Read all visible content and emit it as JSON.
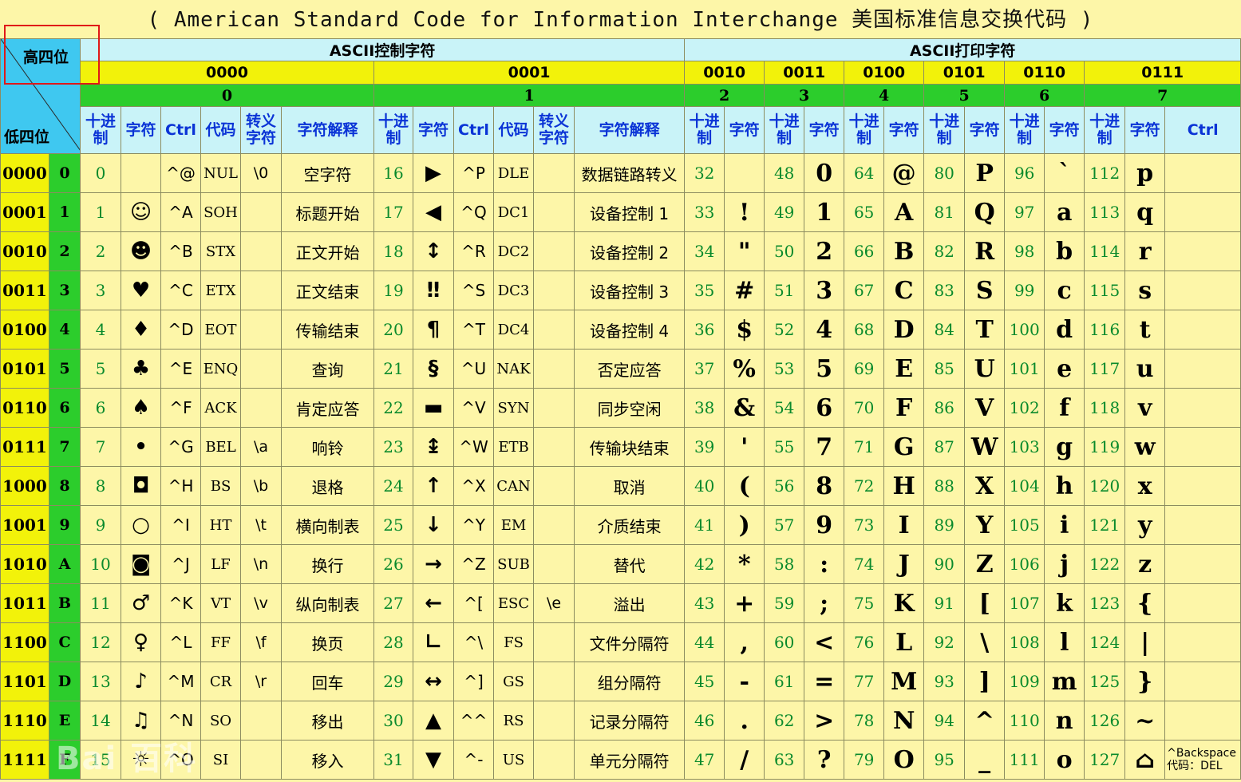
{
  "title": "( American Standard Code for Information Interchange  美国标准信息交换代码 )",
  "corner": {
    "high": "高四位",
    "low": "低四位"
  },
  "sections": {
    "control": "ASCII控制字符",
    "printable": "ASCII打印字符"
  },
  "high_bits": [
    "0000",
    "0001",
    "0010",
    "0011",
    "0100",
    "0101",
    "0110",
    "0111"
  ],
  "high_hex": [
    "0",
    "1",
    "2",
    "3",
    "4",
    "5",
    "6",
    "7"
  ],
  "ctrl_columns": [
    "十进制",
    "字符",
    "Ctrl",
    "代码",
    "转义字符",
    "字符解释"
  ],
  "print_columns": [
    "十进制",
    "字符"
  ],
  "last_ctrl_header": "Ctrl",
  "rows": [
    {
      "bin": "0000",
      "hex": "0",
      "c0": {
        "dec": "0",
        "sym": "",
        "ctrl": "^@",
        "code": "NUL",
        "esc": "\\0",
        "desc": "空字符"
      },
      "c1": {
        "dec": "16",
        "sym": "▶",
        "ctrl": "^P",
        "code": "DLE",
        "esc": "",
        "desc": "数据链路转义"
      },
      "p": [
        {
          "dec": "32",
          "chr": ""
        },
        {
          "dec": "48",
          "chr": "0"
        },
        {
          "dec": "64",
          "chr": "@"
        },
        {
          "dec": "80",
          "chr": "P"
        },
        {
          "dec": "96",
          "chr": "`"
        },
        {
          "dec": "112",
          "chr": "p"
        }
      ],
      "last": ""
    },
    {
      "bin": "0001",
      "hex": "1",
      "c0": {
        "dec": "1",
        "sym": "☺",
        "ctrl": "^A",
        "code": "SOH",
        "esc": "",
        "desc": "标题开始"
      },
      "c1": {
        "dec": "17",
        "sym": "◀",
        "ctrl": "^Q",
        "code": "DC1",
        "esc": "",
        "desc": "设备控制 1"
      },
      "p": [
        {
          "dec": "33",
          "chr": "!"
        },
        {
          "dec": "49",
          "chr": "1"
        },
        {
          "dec": "65",
          "chr": "A"
        },
        {
          "dec": "81",
          "chr": "Q"
        },
        {
          "dec": "97",
          "chr": "a"
        },
        {
          "dec": "113",
          "chr": "q"
        }
      ],
      "last": ""
    },
    {
      "bin": "0010",
      "hex": "2",
      "c0": {
        "dec": "2",
        "sym": "☻",
        "ctrl": "^B",
        "code": "STX",
        "esc": "",
        "desc": "正文开始"
      },
      "c1": {
        "dec": "18",
        "sym": "↕",
        "ctrl": "^R",
        "code": "DC2",
        "esc": "",
        "desc": "设备控制 2"
      },
      "p": [
        {
          "dec": "34",
          "chr": "\""
        },
        {
          "dec": "50",
          "chr": "2"
        },
        {
          "dec": "66",
          "chr": "B"
        },
        {
          "dec": "82",
          "chr": "R"
        },
        {
          "dec": "98",
          "chr": "b"
        },
        {
          "dec": "114",
          "chr": "r"
        }
      ],
      "last": ""
    },
    {
      "bin": "0011",
      "hex": "3",
      "c0": {
        "dec": "3",
        "sym": "♥",
        "ctrl": "^C",
        "code": "ETX",
        "esc": "",
        "desc": "正文结束"
      },
      "c1": {
        "dec": "19",
        "sym": "‼",
        "ctrl": "^S",
        "code": "DC3",
        "esc": "",
        "desc": "设备控制 3"
      },
      "p": [
        {
          "dec": "35",
          "chr": "#"
        },
        {
          "dec": "51",
          "chr": "3"
        },
        {
          "dec": "67",
          "chr": "C"
        },
        {
          "dec": "83",
          "chr": "S"
        },
        {
          "dec": "99",
          "chr": "c"
        },
        {
          "dec": "115",
          "chr": "s"
        }
      ],
      "last": ""
    },
    {
      "bin": "0100",
      "hex": "4",
      "c0": {
        "dec": "4",
        "sym": "♦",
        "ctrl": "^D",
        "code": "EOT",
        "esc": "",
        "desc": "传输结束"
      },
      "c1": {
        "dec": "20",
        "sym": "¶",
        "ctrl": "^T",
        "code": "DC4",
        "esc": "",
        "desc": "设备控制 4"
      },
      "p": [
        {
          "dec": "36",
          "chr": "$"
        },
        {
          "dec": "52",
          "chr": "4"
        },
        {
          "dec": "68",
          "chr": "D"
        },
        {
          "dec": "84",
          "chr": "T"
        },
        {
          "dec": "100",
          "chr": "d"
        },
        {
          "dec": "116",
          "chr": "t"
        }
      ],
      "last": ""
    },
    {
      "bin": "0101",
      "hex": "5",
      "c0": {
        "dec": "5",
        "sym": "♣",
        "ctrl": "^E",
        "code": "ENQ",
        "esc": "",
        "desc": "查询"
      },
      "c1": {
        "dec": "21",
        "sym": "§",
        "ctrl": "^U",
        "code": "NAK",
        "esc": "",
        "desc": "否定应答"
      },
      "p": [
        {
          "dec": "37",
          "chr": "%"
        },
        {
          "dec": "53",
          "chr": "5"
        },
        {
          "dec": "69",
          "chr": "E"
        },
        {
          "dec": "85",
          "chr": "U"
        },
        {
          "dec": "101",
          "chr": "e"
        },
        {
          "dec": "117",
          "chr": "u"
        }
      ],
      "last": ""
    },
    {
      "bin": "0110",
      "hex": "6",
      "c0": {
        "dec": "6",
        "sym": "♠",
        "ctrl": "^F",
        "code": "ACK",
        "esc": "",
        "desc": "肯定应答"
      },
      "c1": {
        "dec": "22",
        "sym": "▬",
        "ctrl": "^V",
        "code": "SYN",
        "esc": "",
        "desc": "同步空闲"
      },
      "p": [
        {
          "dec": "38",
          "chr": "&"
        },
        {
          "dec": "54",
          "chr": "6"
        },
        {
          "dec": "70",
          "chr": "F"
        },
        {
          "dec": "86",
          "chr": "V"
        },
        {
          "dec": "102",
          "chr": "f"
        },
        {
          "dec": "118",
          "chr": "v"
        }
      ],
      "last": ""
    },
    {
      "bin": "0111",
      "hex": "7",
      "c0": {
        "dec": "7",
        "sym": "•",
        "ctrl": "^G",
        "code": "BEL",
        "esc": "\\a",
        "desc": "响铃"
      },
      "c1": {
        "dec": "23",
        "sym": "↨",
        "ctrl": "^W",
        "code": "ETB",
        "esc": "",
        "desc": "传输块结束"
      },
      "p": [
        {
          "dec": "39",
          "chr": "'"
        },
        {
          "dec": "55",
          "chr": "7"
        },
        {
          "dec": "71",
          "chr": "G"
        },
        {
          "dec": "87",
          "chr": "W"
        },
        {
          "dec": "103",
          "chr": "g"
        },
        {
          "dec": "119",
          "chr": "w"
        }
      ],
      "last": ""
    },
    {
      "bin": "1000",
      "hex": "8",
      "c0": {
        "dec": "8",
        "sym": "◘",
        "ctrl": "^H",
        "code": "BS",
        "esc": "\\b",
        "desc": "退格"
      },
      "c1": {
        "dec": "24",
        "sym": "↑",
        "ctrl": "^X",
        "code": "CAN",
        "esc": "",
        "desc": "取消"
      },
      "p": [
        {
          "dec": "40",
          "chr": "("
        },
        {
          "dec": "56",
          "chr": "8"
        },
        {
          "dec": "72",
          "chr": "H"
        },
        {
          "dec": "88",
          "chr": "X"
        },
        {
          "dec": "104",
          "chr": "h"
        },
        {
          "dec": "120",
          "chr": "x"
        }
      ],
      "last": ""
    },
    {
      "bin": "1001",
      "hex": "9",
      "c0": {
        "dec": "9",
        "sym": "○",
        "ctrl": "^I",
        "code": "HT",
        "esc": "\\t",
        "desc": "横向制表"
      },
      "c1": {
        "dec": "25",
        "sym": "↓",
        "ctrl": "^Y",
        "code": "EM",
        "esc": "",
        "desc": "介质结束"
      },
      "p": [
        {
          "dec": "41",
          "chr": ")"
        },
        {
          "dec": "57",
          "chr": "9"
        },
        {
          "dec": "73",
          "chr": "I"
        },
        {
          "dec": "89",
          "chr": "Y"
        },
        {
          "dec": "105",
          "chr": "i"
        },
        {
          "dec": "121",
          "chr": "y"
        }
      ],
      "last": ""
    },
    {
      "bin": "1010",
      "hex": "A",
      "c0": {
        "dec": "10",
        "sym": "◙",
        "ctrl": "^J",
        "code": "LF",
        "esc": "\\n",
        "desc": "换行"
      },
      "c1": {
        "dec": "26",
        "sym": "→",
        "ctrl": "^Z",
        "code": "SUB",
        "esc": "",
        "desc": "替代"
      },
      "p": [
        {
          "dec": "42",
          "chr": "*"
        },
        {
          "dec": "58",
          "chr": ":"
        },
        {
          "dec": "74",
          "chr": "J"
        },
        {
          "dec": "90",
          "chr": "Z"
        },
        {
          "dec": "106",
          "chr": "j"
        },
        {
          "dec": "122",
          "chr": "z"
        }
      ],
      "last": ""
    },
    {
      "bin": "1011",
      "hex": "B",
      "c0": {
        "dec": "11",
        "sym": "♂",
        "ctrl": "^K",
        "code": "VT",
        "esc": "\\v",
        "desc": "纵向制表"
      },
      "c1": {
        "dec": "27",
        "sym": "←",
        "ctrl": "^[",
        "code": "ESC",
        "esc": "\\e",
        "desc": "溢出"
      },
      "p": [
        {
          "dec": "43",
          "chr": "+"
        },
        {
          "dec": "59",
          "chr": ";"
        },
        {
          "dec": "75",
          "chr": "K"
        },
        {
          "dec": "91",
          "chr": "["
        },
        {
          "dec": "107",
          "chr": "k"
        },
        {
          "dec": "123",
          "chr": "{"
        }
      ],
      "last": ""
    },
    {
      "bin": "1100",
      "hex": "C",
      "c0": {
        "dec": "12",
        "sym": "♀",
        "ctrl": "^L",
        "code": "FF",
        "esc": "\\f",
        "desc": "换页"
      },
      "c1": {
        "dec": "28",
        "sym": "∟",
        "ctrl": "^\\",
        "code": "FS",
        "esc": "",
        "desc": "文件分隔符"
      },
      "p": [
        {
          "dec": "44",
          "chr": ","
        },
        {
          "dec": "60",
          "chr": "<"
        },
        {
          "dec": "76",
          "chr": "L"
        },
        {
          "dec": "92",
          "chr": "\\"
        },
        {
          "dec": "108",
          "chr": "l"
        },
        {
          "dec": "124",
          "chr": "|"
        }
      ],
      "last": ""
    },
    {
      "bin": "1101",
      "hex": "D",
      "c0": {
        "dec": "13",
        "sym": "♪",
        "ctrl": "^M",
        "code": "CR",
        "esc": "\\r",
        "desc": "回车"
      },
      "c1": {
        "dec": "29",
        "sym": "↔",
        "ctrl": "^]",
        "code": "GS",
        "esc": "",
        "desc": "组分隔符"
      },
      "p": [
        {
          "dec": "45",
          "chr": "-"
        },
        {
          "dec": "61",
          "chr": "="
        },
        {
          "dec": "77",
          "chr": "M"
        },
        {
          "dec": "93",
          "chr": "]"
        },
        {
          "dec": "109",
          "chr": "m"
        },
        {
          "dec": "125",
          "chr": "}"
        }
      ],
      "last": ""
    },
    {
      "bin": "1110",
      "hex": "E",
      "c0": {
        "dec": "14",
        "sym": "♫",
        "ctrl": "^N",
        "code": "SO",
        "esc": "",
        "desc": "移出"
      },
      "c1": {
        "dec": "30",
        "sym": "▲",
        "ctrl": "^^",
        "code": "RS",
        "esc": "",
        "desc": "记录分隔符"
      },
      "p": [
        {
          "dec": "46",
          "chr": "."
        },
        {
          "dec": "62",
          "chr": ">"
        },
        {
          "dec": "78",
          "chr": "N"
        },
        {
          "dec": "94",
          "chr": "^"
        },
        {
          "dec": "110",
          "chr": "n"
        },
        {
          "dec": "126",
          "chr": "~"
        }
      ],
      "last": ""
    },
    {
      "bin": "1111",
      "hex": "F",
      "c0": {
        "dec": "15",
        "sym": "☼",
        "ctrl": "^O",
        "code": "SI",
        "esc": "",
        "desc": "移入"
      },
      "c1": {
        "dec": "31",
        "sym": "▼",
        "ctrl": "^-",
        "code": "US",
        "esc": "",
        "desc": "单元分隔符"
      },
      "p": [
        {
          "dec": "47",
          "chr": "/"
        },
        {
          "dec": "63",
          "chr": "?"
        },
        {
          "dec": "79",
          "chr": "O"
        },
        {
          "dec": "95",
          "chr": "_"
        },
        {
          "dec": "111",
          "chr": "o"
        },
        {
          "dec": "127",
          "chr": "⌂"
        }
      ],
      "last": "^Backspace 代码：DEL"
    }
  ],
  "watermark": "Bai 百科",
  "colors": {
    "background": "#fdf6a8",
    "binary_bg": "#f2f20a",
    "hex_bg": "#2ccd2c",
    "header_bg": "#c9f3f8",
    "corner_bg": "#3fc8f0",
    "decimal_text": "#0a8a2c",
    "header_text": "#0a33d6",
    "highlight_box": "#e01818"
  }
}
